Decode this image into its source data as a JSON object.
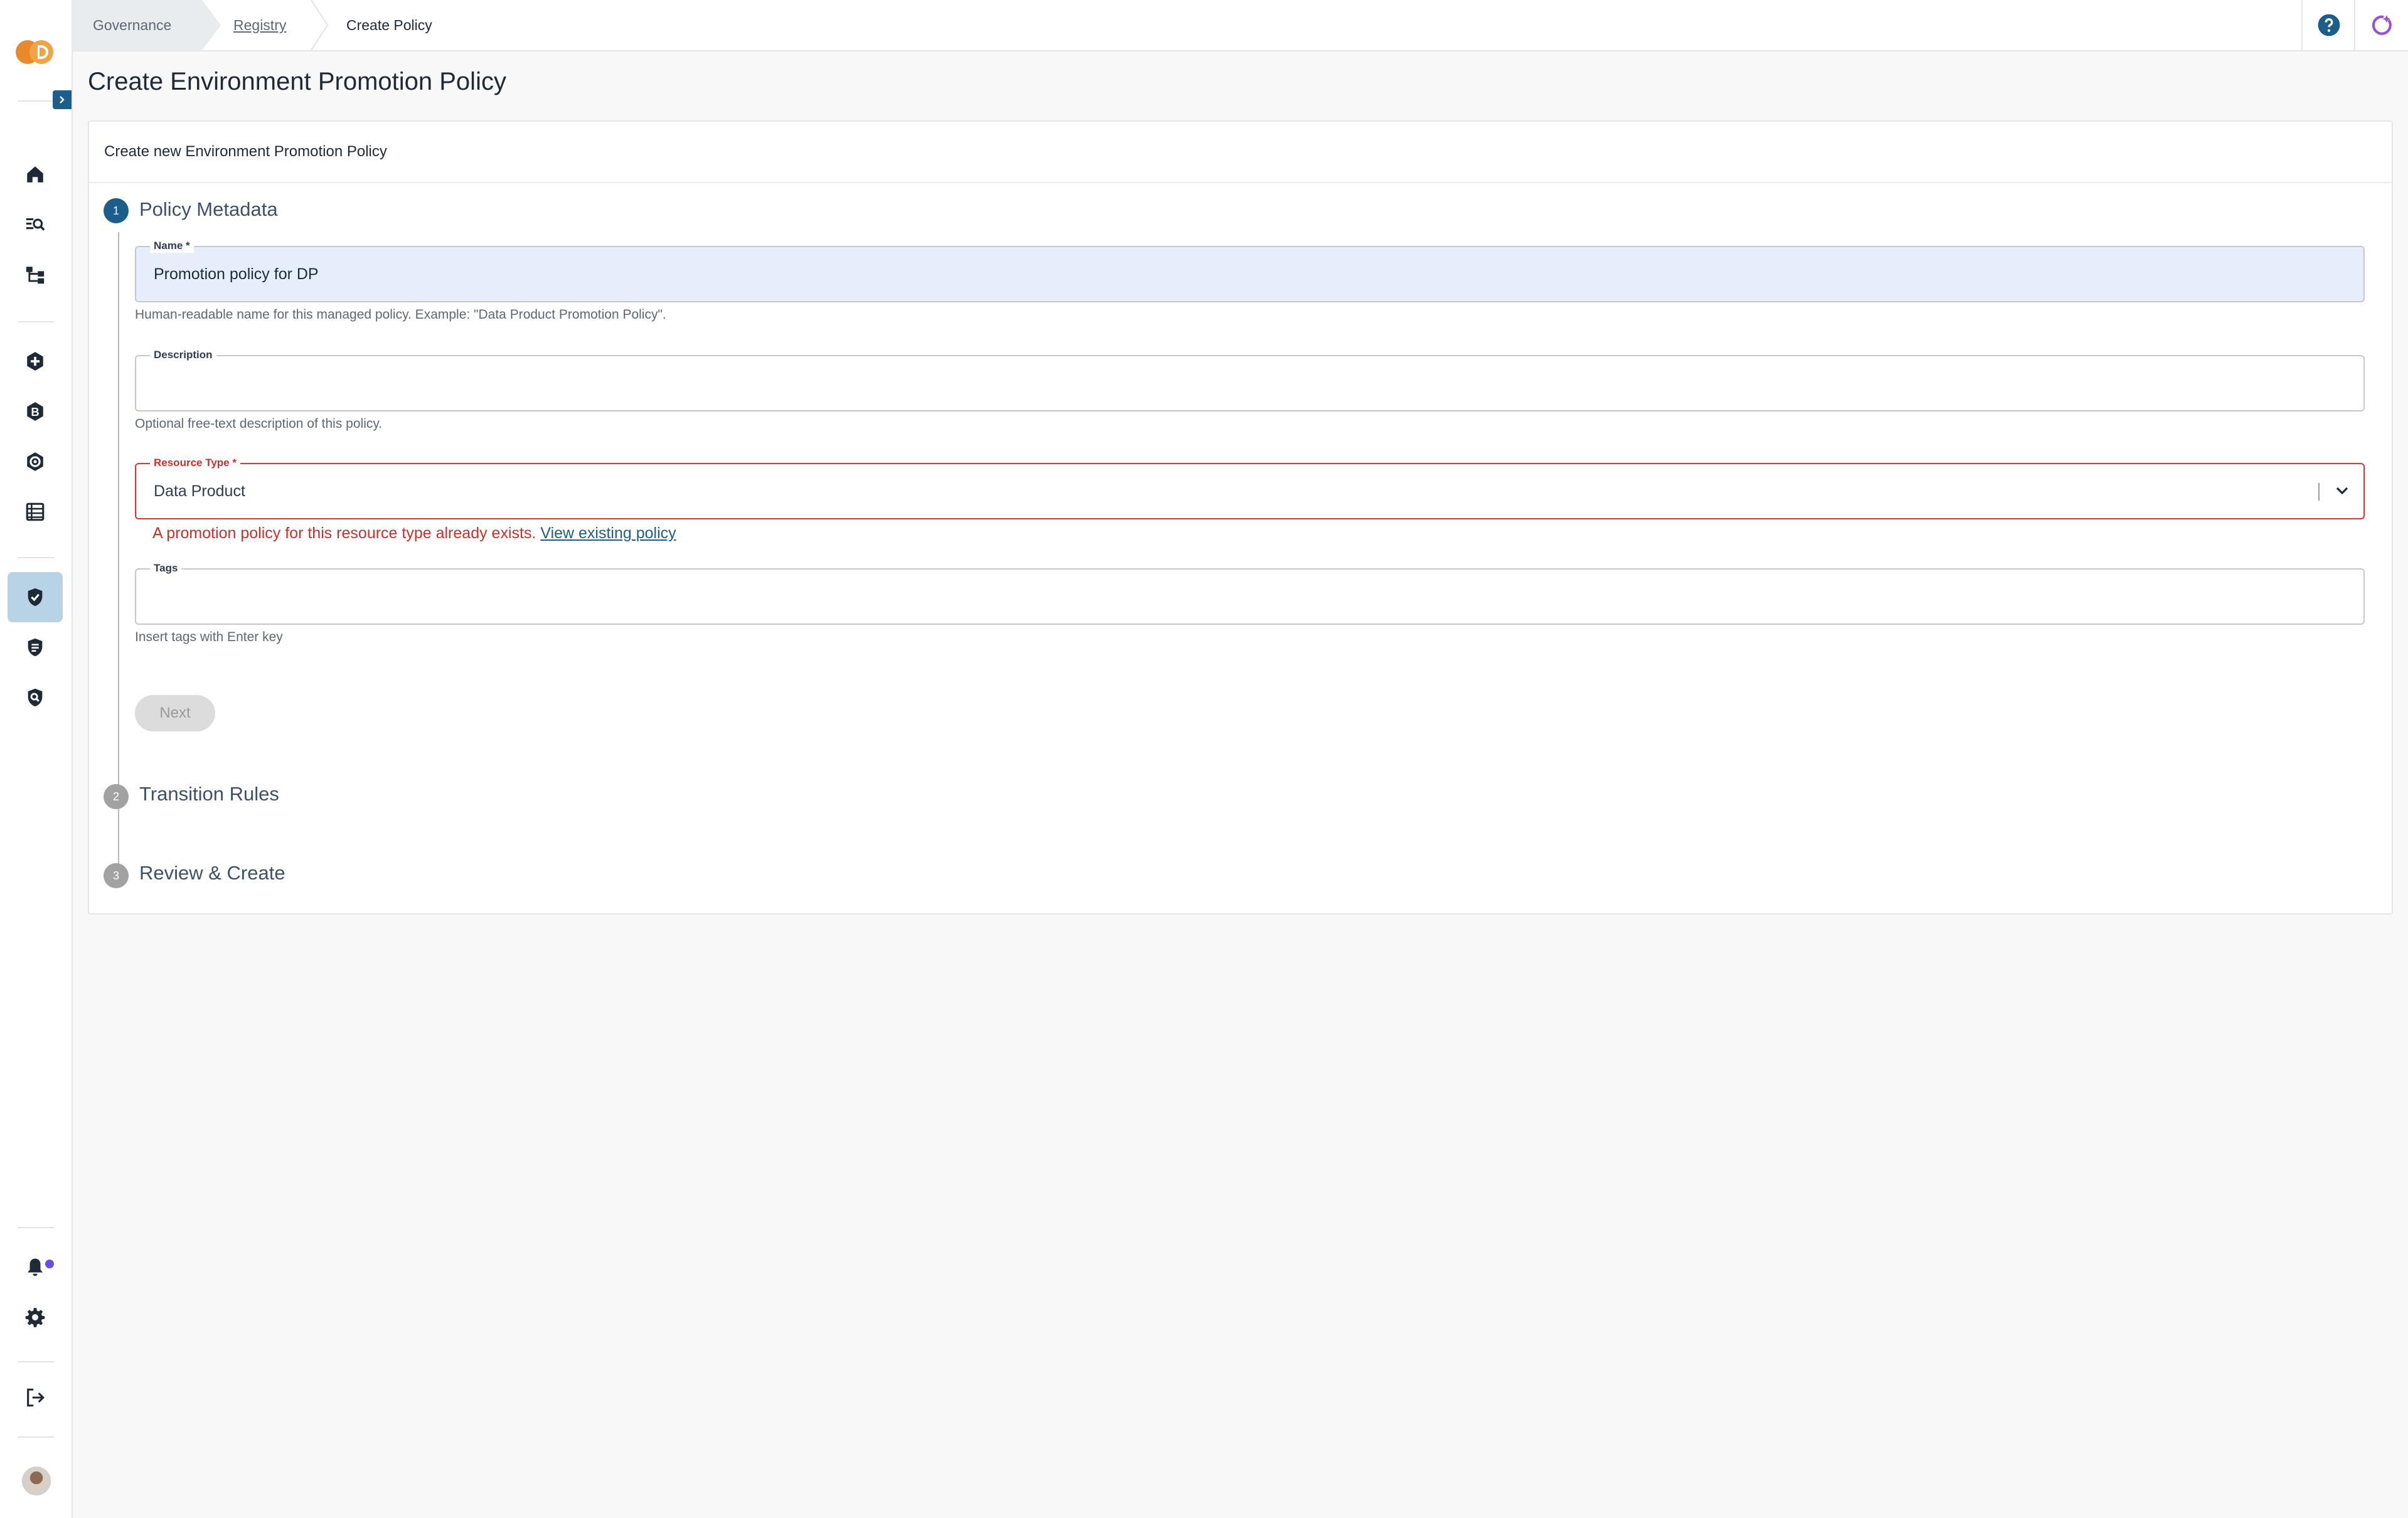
{
  "breadcrumb": {
    "items": [
      "Governance",
      "Registry",
      "Create Policy"
    ]
  },
  "page": {
    "title": "Create Environment Promotion Policy"
  },
  "card": {
    "header": "Create new Environment Promotion Policy"
  },
  "steps": [
    {
      "number": "1",
      "title": "Policy Metadata",
      "state": "active"
    },
    {
      "number": "2",
      "title": "Transition Rules",
      "state": "inactive"
    },
    {
      "number": "3",
      "title": "Review & Create",
      "state": "inactive"
    }
  ],
  "form": {
    "name": {
      "label": "Name *",
      "value": "Promotion policy for DP",
      "helper": "Human-readable name for this managed policy. Example: \"Data Product Promotion Policy\"."
    },
    "description": {
      "label": "Description",
      "value": "",
      "helper": "Optional free-text description of this policy."
    },
    "resource_type": {
      "label": "Resource Type *",
      "value": "Data Product",
      "error": "A promotion policy for this resource type already exists.",
      "error_link": "View existing policy"
    },
    "tags": {
      "label": "Tags",
      "value": "",
      "helper": "Insert tags with Enter key"
    },
    "next_label": "Next"
  },
  "sidebar": {
    "items": [
      {
        "icon": "home-icon"
      },
      {
        "icon": "search-list-icon"
      },
      {
        "icon": "hierarchy-icon"
      },
      {
        "icon": "plus-hexagon-icon"
      },
      {
        "icon": "b-hexagon-icon"
      },
      {
        "icon": "target-hexagon-icon"
      },
      {
        "icon": "table-icon"
      },
      {
        "icon": "shield-check-icon",
        "active": true
      },
      {
        "icon": "shield-list-icon"
      },
      {
        "icon": "shield-search-icon"
      },
      {
        "icon": "bell-icon"
      },
      {
        "icon": "gear-icon"
      },
      {
        "icon": "logout-icon"
      }
    ]
  },
  "colors": {
    "accent": "#1b5e8c",
    "error": "#c9302c",
    "active_nav": "#b9d3e6",
    "logo_orange": "#e8892b",
    "notification": "#6b4de6"
  }
}
